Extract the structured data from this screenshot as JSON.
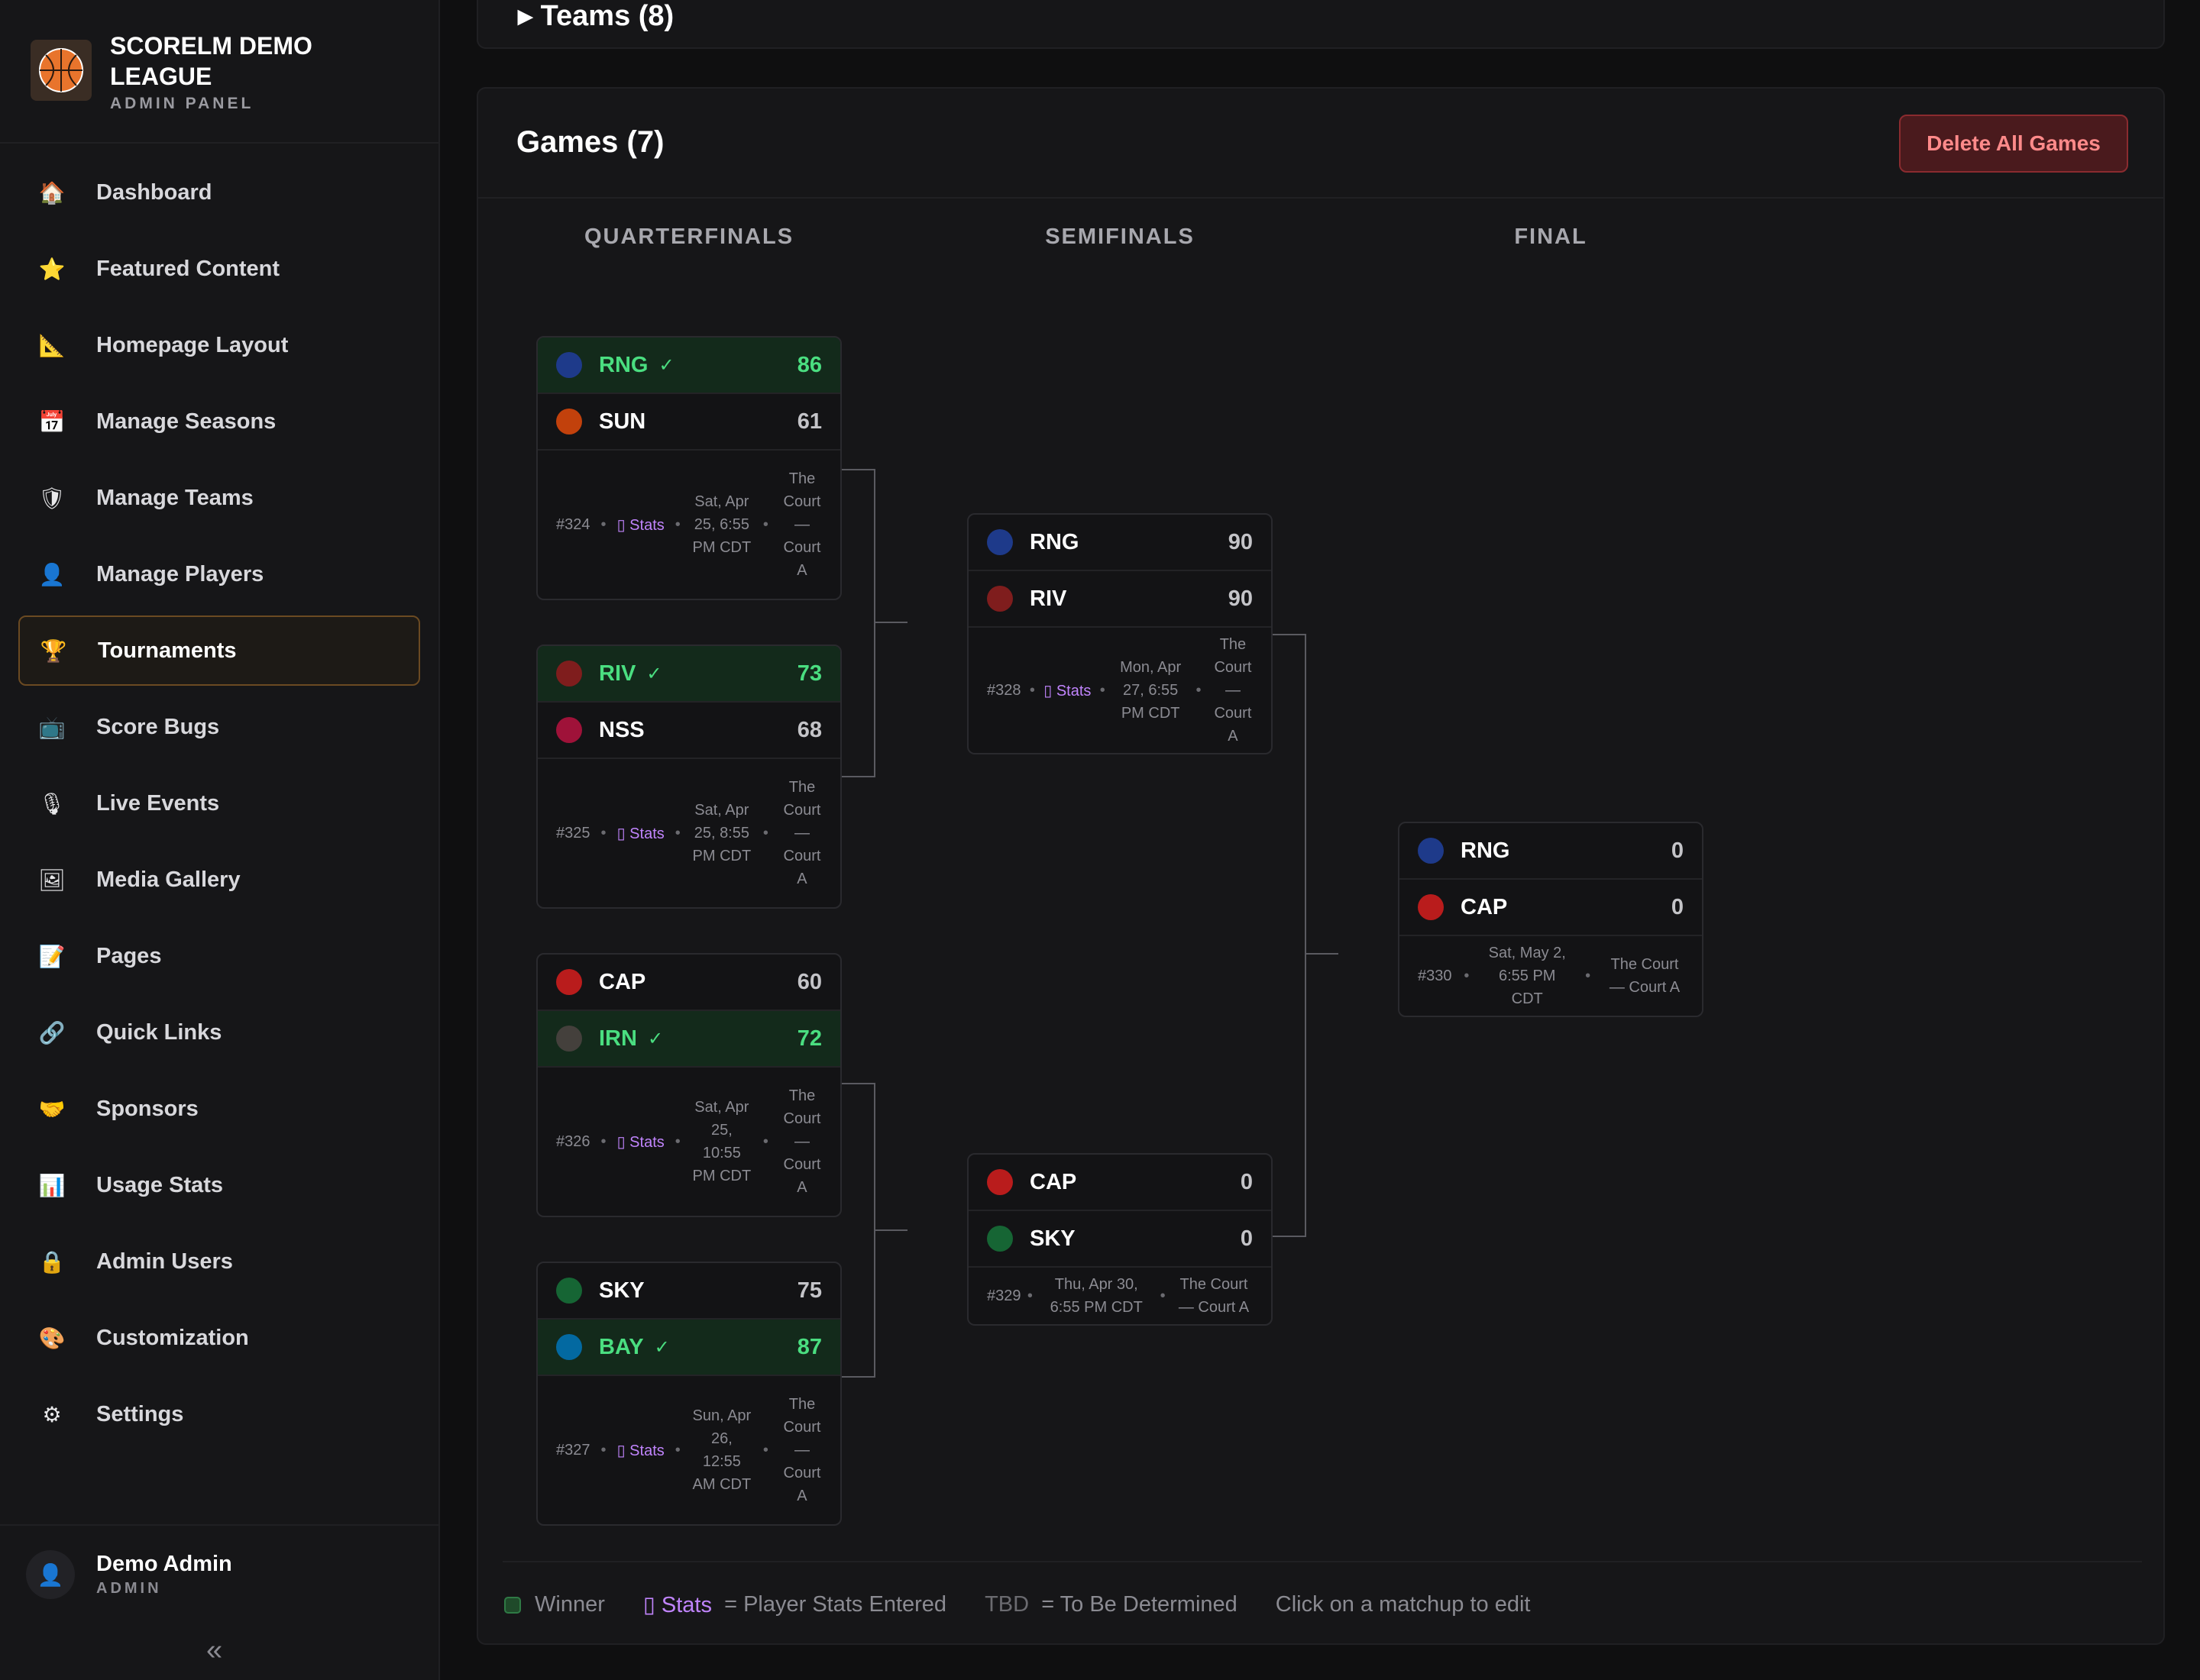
{
  "sidebar": {
    "brand_title": "SCORELM DEMO LEAGUE",
    "brand_sub": "ADMIN PANEL",
    "items": [
      {
        "label": "Dashboard",
        "icon": "🏠"
      },
      {
        "label": "Featured Content",
        "icon": "⭐"
      },
      {
        "label": "Homepage Layout",
        "icon": "📐"
      },
      {
        "label": "Manage Seasons",
        "icon": "📅"
      },
      {
        "label": "Manage Teams",
        "icon": "🛡"
      },
      {
        "label": "Manage Players",
        "icon": "👤"
      },
      {
        "label": "Tournaments",
        "icon": "🏆"
      },
      {
        "label": "Score Bugs",
        "icon": "📺"
      },
      {
        "label": "Live Events",
        "icon": "🎙"
      },
      {
        "label": "Media Gallery",
        "icon": "🖼"
      },
      {
        "label": "Pages",
        "icon": "📝"
      },
      {
        "label": "Quick Links",
        "icon": "🔗"
      },
      {
        "label": "Sponsors",
        "icon": "🤝"
      },
      {
        "label": "Usage Stats",
        "icon": "📊"
      },
      {
        "label": "Admin Users",
        "icon": "🔒"
      },
      {
        "label": "Customization",
        "icon": "🎨"
      },
      {
        "label": "Settings",
        "icon": "⚙"
      }
    ],
    "active": "Tournaments",
    "user_name": "Demo Admin",
    "user_role": "ADMIN",
    "collapse": "«"
  },
  "teams_panel": {
    "title": "▸  Teams (8)"
  },
  "games": {
    "title": "Games (7)",
    "delete_label": "Delete All Games",
    "rounds": [
      "QUARTERFINALS",
      "SEMIFINALS",
      "FINAL"
    ]
  },
  "matches": {
    "m324": {
      "id": "#324",
      "stats": "▯ Stats",
      "date": "Sat, Apr 25, 6:55 PM CDT",
      "venue": "The Court — Court A",
      "t1": {
        "name": "RNG",
        "score": "86",
        "win": true
      },
      "t2": {
        "name": "SUN",
        "score": "61",
        "win": false
      }
    },
    "m325": {
      "id": "#325",
      "stats": "▯ Stats",
      "date": "Sat, Apr 25, 8:55 PM CDT",
      "venue": "The Court — Court A",
      "t1": {
        "name": "RIV",
        "score": "73",
        "win": true
      },
      "t2": {
        "name": "NSS",
        "score": "68",
        "win": false
      }
    },
    "m326": {
      "id": "#326",
      "stats": "▯ Stats",
      "date": "Sat, Apr 25, 10:55 PM CDT",
      "venue": "The Court — Court A",
      "t1": {
        "name": "CAP",
        "score": "60",
        "win": false
      },
      "t2": {
        "name": "IRN",
        "score": "72",
        "win": true
      }
    },
    "m327": {
      "id": "#327",
      "stats": "▯ Stats",
      "date": "Sun, Apr 26, 12:55 AM CDT",
      "venue": "The Court — Court A",
      "t1": {
        "name": "SKY",
        "score": "75",
        "win": false
      },
      "t2": {
        "name": "BAY",
        "score": "87",
        "win": true
      }
    },
    "m328": {
      "id": "#328",
      "stats": "▯ Stats",
      "date": "Mon, Apr 27, 6:55 PM CDT",
      "venue": "The Court — Court A",
      "t1": {
        "name": "RNG",
        "score": "90",
        "win": false
      },
      "t2": {
        "name": "RIV",
        "score": "90",
        "win": false
      }
    },
    "m329": {
      "id": "#329",
      "date": "Thu, Apr 30, 6:55 PM CDT",
      "venue": "The Court — Court A",
      "t1": {
        "name": "CAP",
        "score": "0",
        "win": false
      },
      "t2": {
        "name": "SKY",
        "score": "0",
        "win": false
      }
    },
    "m330": {
      "id": "#330",
      "date": "Sat, May 2, 6:55 PM CDT",
      "venue": "The Court — Court A",
      "t1": {
        "name": "RNG",
        "score": "0",
        "win": false
      },
      "t2": {
        "name": "CAP",
        "score": "0",
        "win": false
      }
    }
  },
  "team_colors": {
    "RNG": "#1e3a8a",
    "SUN": "#c2410c",
    "RIV": "#7f1d1d",
    "NSS": "#9f1239",
    "CAP": "#b91c1c",
    "IRN": "#44403c",
    "SKY": "#166534",
    "BAY": "#0369a1"
  },
  "legend": {
    "winner": "Winner",
    "stats_key": "▯ Stats",
    "stats_desc": "= Player Stats Entered",
    "tbd_key": "TBD",
    "tbd_desc": "= To Be Determined",
    "hint": "Click on a matchup to edit"
  }
}
